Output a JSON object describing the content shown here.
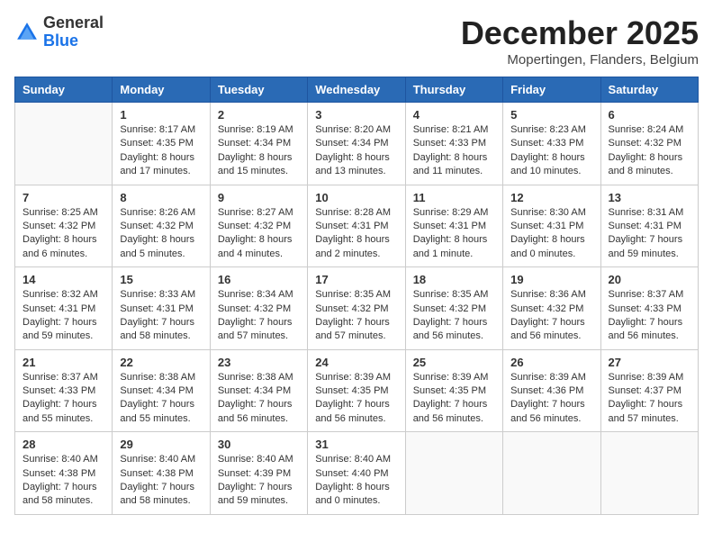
{
  "header": {
    "logo_line1": "General",
    "logo_line2": "Blue",
    "month_title": "December 2025",
    "location": "Mopertingen, Flanders, Belgium"
  },
  "weekdays": [
    "Sunday",
    "Monday",
    "Tuesday",
    "Wednesday",
    "Thursday",
    "Friday",
    "Saturday"
  ],
  "weeks": [
    [
      {
        "day": "",
        "info": ""
      },
      {
        "day": "1",
        "info": "Sunrise: 8:17 AM\nSunset: 4:35 PM\nDaylight: 8 hours\nand 17 minutes."
      },
      {
        "day": "2",
        "info": "Sunrise: 8:19 AM\nSunset: 4:34 PM\nDaylight: 8 hours\nand 15 minutes."
      },
      {
        "day": "3",
        "info": "Sunrise: 8:20 AM\nSunset: 4:34 PM\nDaylight: 8 hours\nand 13 minutes."
      },
      {
        "day": "4",
        "info": "Sunrise: 8:21 AM\nSunset: 4:33 PM\nDaylight: 8 hours\nand 11 minutes."
      },
      {
        "day": "5",
        "info": "Sunrise: 8:23 AM\nSunset: 4:33 PM\nDaylight: 8 hours\nand 10 minutes."
      },
      {
        "day": "6",
        "info": "Sunrise: 8:24 AM\nSunset: 4:32 PM\nDaylight: 8 hours\nand 8 minutes."
      }
    ],
    [
      {
        "day": "7",
        "info": "Sunrise: 8:25 AM\nSunset: 4:32 PM\nDaylight: 8 hours\nand 6 minutes."
      },
      {
        "day": "8",
        "info": "Sunrise: 8:26 AM\nSunset: 4:32 PM\nDaylight: 8 hours\nand 5 minutes."
      },
      {
        "day": "9",
        "info": "Sunrise: 8:27 AM\nSunset: 4:32 PM\nDaylight: 8 hours\nand 4 minutes."
      },
      {
        "day": "10",
        "info": "Sunrise: 8:28 AM\nSunset: 4:31 PM\nDaylight: 8 hours\nand 2 minutes."
      },
      {
        "day": "11",
        "info": "Sunrise: 8:29 AM\nSunset: 4:31 PM\nDaylight: 8 hours\nand 1 minute."
      },
      {
        "day": "12",
        "info": "Sunrise: 8:30 AM\nSunset: 4:31 PM\nDaylight: 8 hours\nand 0 minutes."
      },
      {
        "day": "13",
        "info": "Sunrise: 8:31 AM\nSunset: 4:31 PM\nDaylight: 7 hours\nand 59 minutes."
      }
    ],
    [
      {
        "day": "14",
        "info": "Sunrise: 8:32 AM\nSunset: 4:31 PM\nDaylight: 7 hours\nand 59 minutes."
      },
      {
        "day": "15",
        "info": "Sunrise: 8:33 AM\nSunset: 4:31 PM\nDaylight: 7 hours\nand 58 minutes."
      },
      {
        "day": "16",
        "info": "Sunrise: 8:34 AM\nSunset: 4:32 PM\nDaylight: 7 hours\nand 57 minutes."
      },
      {
        "day": "17",
        "info": "Sunrise: 8:35 AM\nSunset: 4:32 PM\nDaylight: 7 hours\nand 57 minutes."
      },
      {
        "day": "18",
        "info": "Sunrise: 8:35 AM\nSunset: 4:32 PM\nDaylight: 7 hours\nand 56 minutes."
      },
      {
        "day": "19",
        "info": "Sunrise: 8:36 AM\nSunset: 4:32 PM\nDaylight: 7 hours\nand 56 minutes."
      },
      {
        "day": "20",
        "info": "Sunrise: 8:37 AM\nSunset: 4:33 PM\nDaylight: 7 hours\nand 56 minutes."
      }
    ],
    [
      {
        "day": "21",
        "info": "Sunrise: 8:37 AM\nSunset: 4:33 PM\nDaylight: 7 hours\nand 55 minutes."
      },
      {
        "day": "22",
        "info": "Sunrise: 8:38 AM\nSunset: 4:34 PM\nDaylight: 7 hours\nand 55 minutes."
      },
      {
        "day": "23",
        "info": "Sunrise: 8:38 AM\nSunset: 4:34 PM\nDaylight: 7 hours\nand 56 minutes."
      },
      {
        "day": "24",
        "info": "Sunrise: 8:39 AM\nSunset: 4:35 PM\nDaylight: 7 hours\nand 56 minutes."
      },
      {
        "day": "25",
        "info": "Sunrise: 8:39 AM\nSunset: 4:35 PM\nDaylight: 7 hours\nand 56 minutes."
      },
      {
        "day": "26",
        "info": "Sunrise: 8:39 AM\nSunset: 4:36 PM\nDaylight: 7 hours\nand 56 minutes."
      },
      {
        "day": "27",
        "info": "Sunrise: 8:39 AM\nSunset: 4:37 PM\nDaylight: 7 hours\nand 57 minutes."
      }
    ],
    [
      {
        "day": "28",
        "info": "Sunrise: 8:40 AM\nSunset: 4:38 PM\nDaylight: 7 hours\nand 58 minutes."
      },
      {
        "day": "29",
        "info": "Sunrise: 8:40 AM\nSunset: 4:38 PM\nDaylight: 7 hours\nand 58 minutes."
      },
      {
        "day": "30",
        "info": "Sunrise: 8:40 AM\nSunset: 4:39 PM\nDaylight: 7 hours\nand 59 minutes."
      },
      {
        "day": "31",
        "info": "Sunrise: 8:40 AM\nSunset: 4:40 PM\nDaylight: 8 hours\nand 0 minutes."
      },
      {
        "day": "",
        "info": ""
      },
      {
        "day": "",
        "info": ""
      },
      {
        "day": "",
        "info": ""
      }
    ]
  ]
}
